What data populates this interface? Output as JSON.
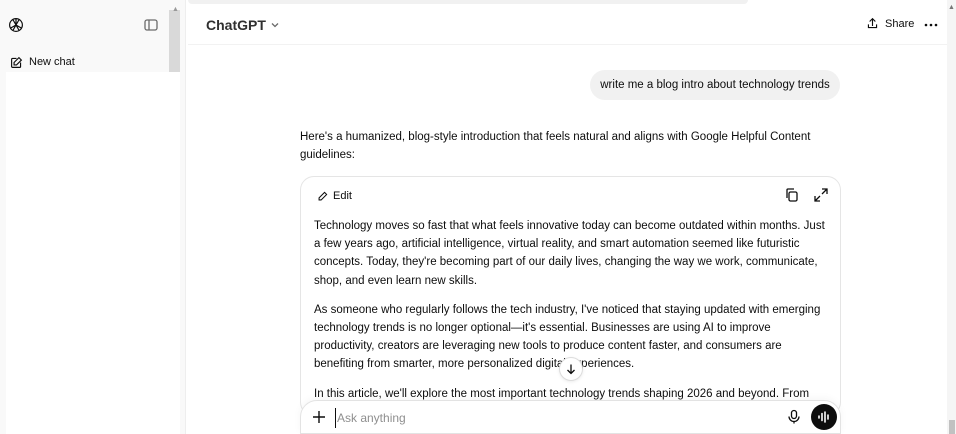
{
  "sidebar": {
    "new_chat_label": "New chat"
  },
  "header": {
    "model_name": "ChatGPT",
    "share_label": "Share"
  },
  "chat": {
    "user_message": "write me a blog intro about technology trends",
    "assistant_intro": "Here's a humanized, blog-style introduction that feels natural and aligns with Google Helpful Content guidelines:",
    "canvas": {
      "edit_label": "Edit",
      "paragraphs": [
        "Technology moves so fast that what feels innovative today can become outdated within months. Just a few years ago, artificial intelligence, virtual reality, and smart automation seemed like futuristic concepts. Today, they're becoming part of our daily lives, changing the way we work, communicate, shop, and even learn new skills.",
        "As someone who regularly follows the tech industry, I've noticed that staying updated with emerging technology trends is no longer optional—it's essential. Businesses are using AI to improve productivity, creators are leveraging new tools to produce content faster, and consumers are benefiting from smarter, more personalized digital experiences.",
        "In this article, we'll explore the most important technology trends shaping 2026 and beyond. From"
      ]
    }
  },
  "composer": {
    "placeholder": "Ask anything",
    "value": ""
  },
  "colors": {
    "accent": "#0d0d0d",
    "sidebar_bg": "#f9f9f9",
    "bubble_bg": "#f1f1f1"
  },
  "icons": {
    "logo": "openai-logo-icon",
    "sidebar_toggle": "sidebar-toggle-icon",
    "new_chat": "edit-pencil-icon",
    "share": "share-upload-icon",
    "more": "more-dots-icon",
    "copy": "copy-icon",
    "expand": "expand-icon",
    "scroll_down": "arrow-down-icon",
    "plus": "plus-icon",
    "mic": "microphone-icon",
    "voice": "voice-wave-icon"
  }
}
